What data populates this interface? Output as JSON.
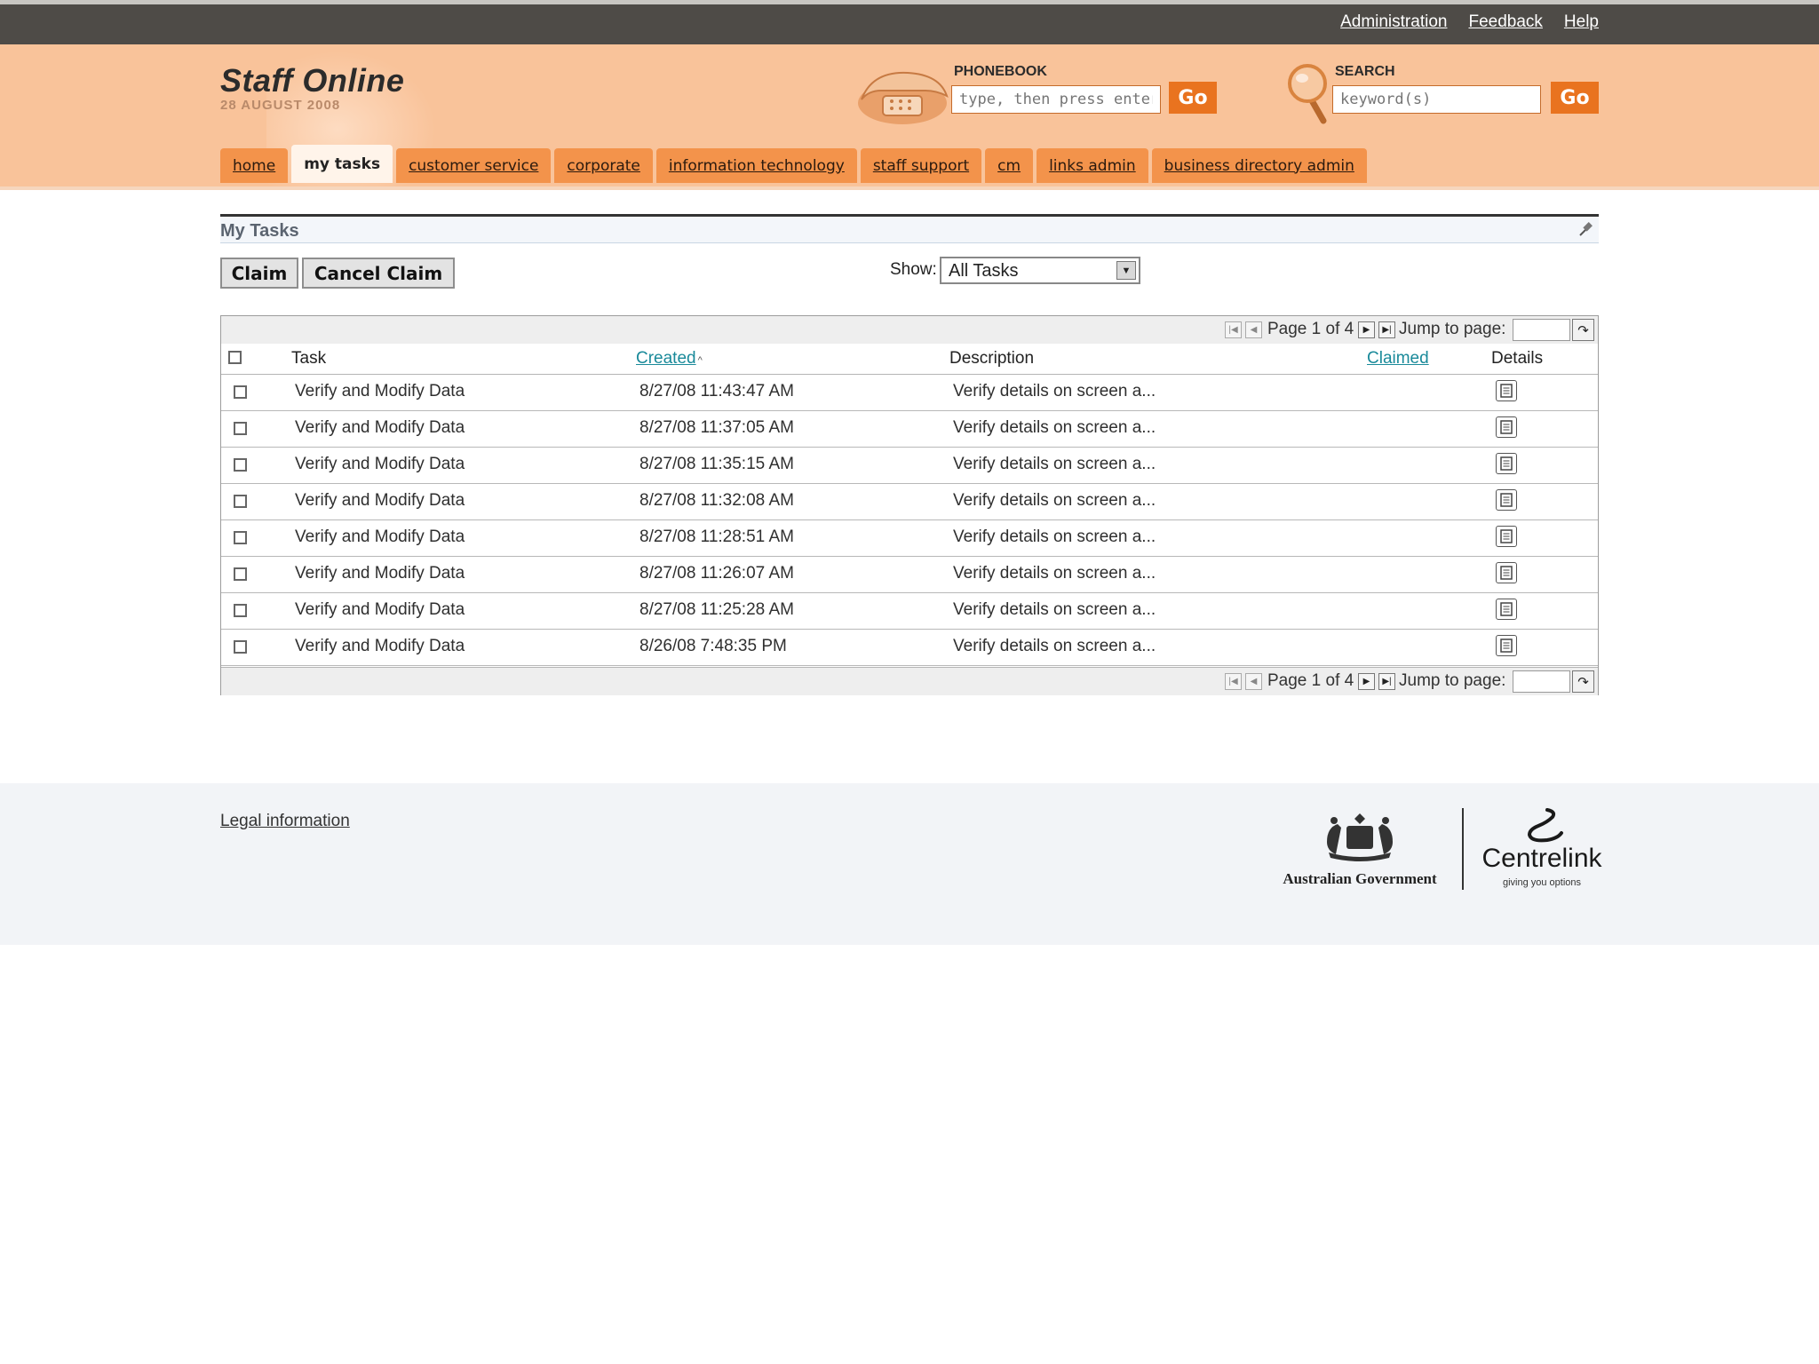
{
  "top_links": [
    "Administration",
    "Feedback",
    "Help"
  ],
  "header": {
    "title": "Staff Online",
    "date": "28 AUGUST 2008",
    "phonebook": {
      "label": "PHONEBOOK",
      "placeholder": "type, then press enter",
      "go": "Go"
    },
    "search": {
      "label": "SEARCH",
      "placeholder": "keyword(s)",
      "go": "Go"
    }
  },
  "nav": {
    "tabs": [
      "home",
      "my tasks",
      "customer service",
      "corporate",
      "information technology",
      "staff support",
      "cm",
      "links admin",
      "business directory admin"
    ],
    "active": "my tasks"
  },
  "panel": {
    "title": "My Tasks",
    "claim_label": "Claim",
    "cancel_claim_label": "Cancel Claim",
    "show_label": "Show:",
    "show_value": "All Tasks"
  },
  "pager": {
    "page_text": "Page 1 of 4",
    "jump_label": "Jump to page:"
  },
  "table": {
    "columns": {
      "task": "Task",
      "created": "Created",
      "description": "Description",
      "claimed": "Claimed",
      "details": "Details"
    },
    "rows": [
      {
        "task": "Verify and Modify Data",
        "created": "8/27/08 11:43:47 AM",
        "description": "Verify details on screen a...",
        "claimed": ""
      },
      {
        "task": "Verify and Modify Data",
        "created": "8/27/08 11:37:05 AM",
        "description": "Verify details on screen a...",
        "claimed": ""
      },
      {
        "task": "Verify and Modify Data",
        "created": "8/27/08 11:35:15 AM",
        "description": "Verify details on screen a...",
        "claimed": ""
      },
      {
        "task": "Verify and Modify Data",
        "created": "8/27/08 11:32:08 AM",
        "description": "Verify details on screen a...",
        "claimed": ""
      },
      {
        "task": "Verify and Modify Data",
        "created": "8/27/08 11:28:51 AM",
        "description": "Verify details on screen a...",
        "claimed": ""
      },
      {
        "task": "Verify and Modify Data",
        "created": "8/27/08 11:26:07 AM",
        "description": "Verify details on screen a...",
        "claimed": ""
      },
      {
        "task": "Verify and Modify Data",
        "created": "8/27/08 11:25:28 AM",
        "description": "Verify details on screen a...",
        "claimed": ""
      },
      {
        "task": "Verify and Modify Data",
        "created": "8/26/08 7:48:35 PM",
        "description": "Verify details on screen a...",
        "claimed": ""
      }
    ]
  },
  "footer": {
    "legal": "Legal information",
    "ag_logo_text": "Australian Government",
    "centrelink_text": "Centrelink",
    "centrelink_tagline": "giving you options"
  },
  "colors": {
    "top_bar": "#4e4b47",
    "header_bg": "#f9c39a",
    "tab_bg": "#f3934b",
    "go_button": "#e9731f",
    "sort_link": "#1a8a9a"
  },
  "icons": [
    "telephone-icon",
    "magnifier-icon",
    "pin-icon",
    "first-page-icon",
    "prev-page-icon",
    "next-page-icon",
    "last-page-icon",
    "go-arrow-icon",
    "details-document-icon",
    "sort-ascending-icon",
    "dropdown-arrow-icon"
  ]
}
